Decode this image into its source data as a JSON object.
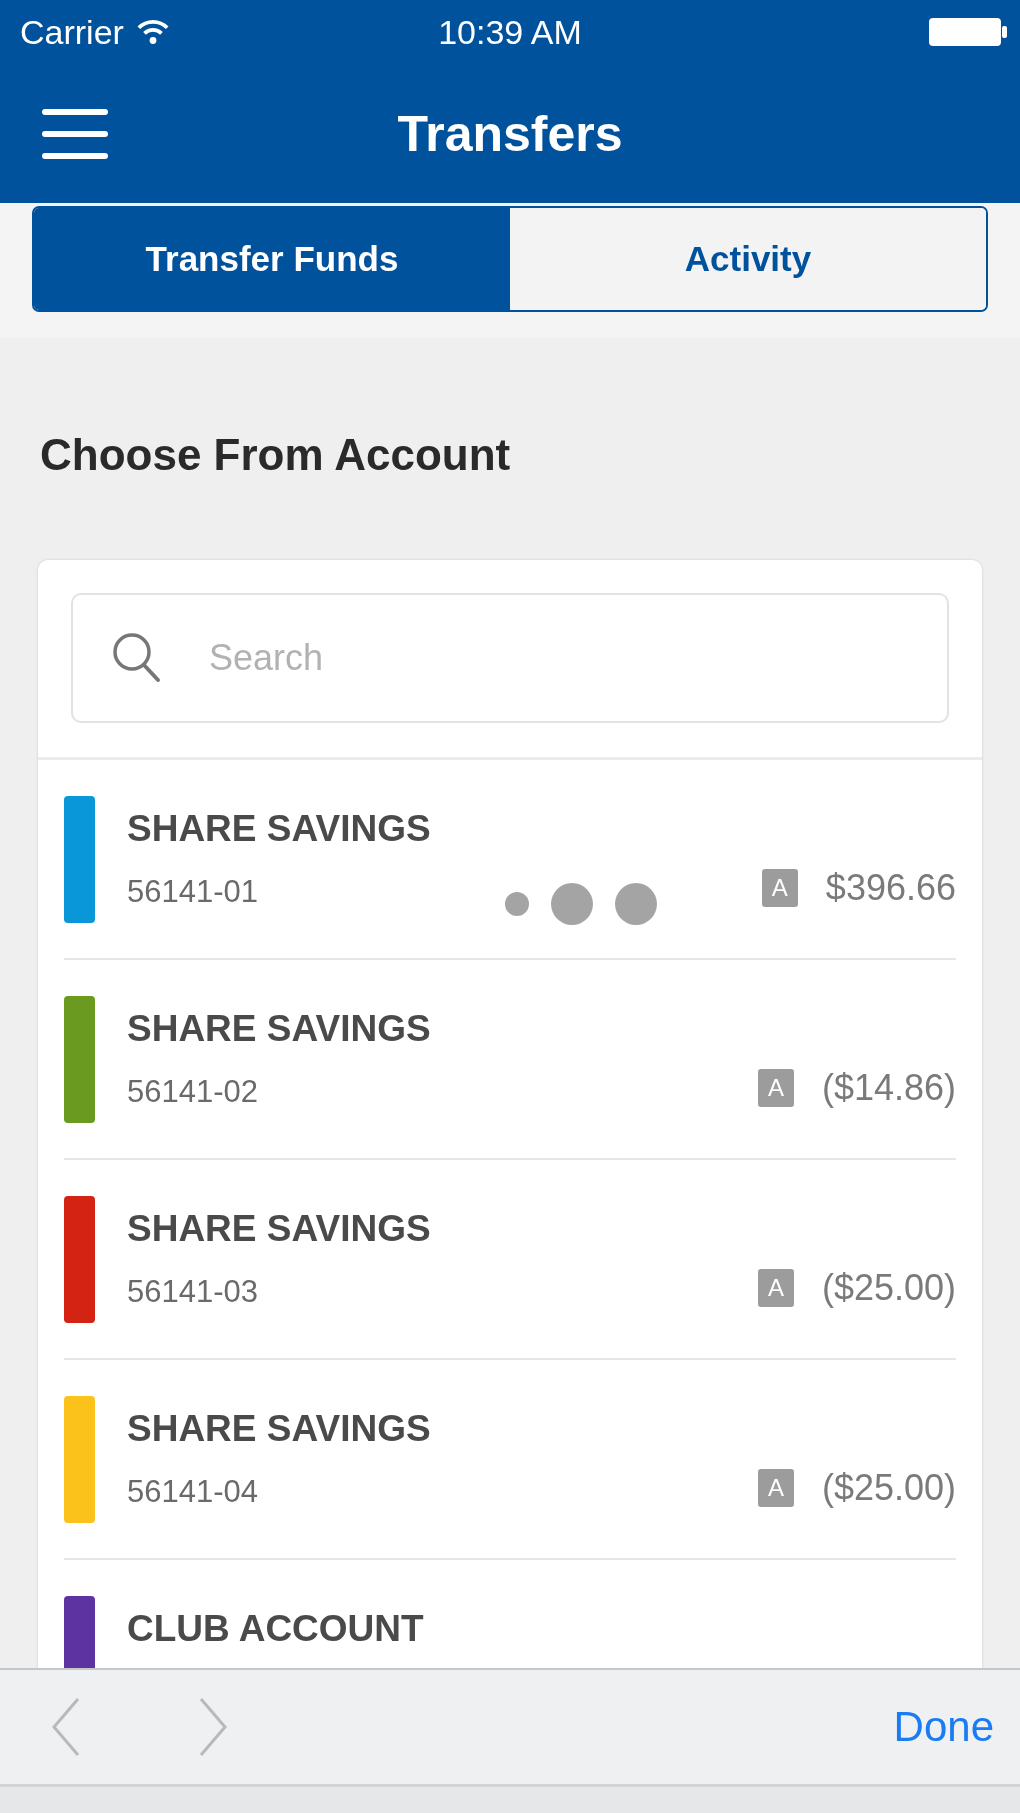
{
  "status_bar": {
    "carrier": "Carrier",
    "time": "10:39 AM"
  },
  "nav": {
    "title": "Transfers"
  },
  "tabs": [
    {
      "label": "Transfer Funds",
      "selected": true
    },
    {
      "label": "Activity",
      "selected": false
    }
  ],
  "heading": "Choose From Account",
  "search": {
    "placeholder": "Search"
  },
  "accounts": [
    {
      "name": "SHARE SAVINGS",
      "number": "56141-01",
      "badge": "A",
      "amount": "$396.66",
      "color": "#0a97d9",
      "loading": true
    },
    {
      "name": "SHARE SAVINGS",
      "number": "56141-02",
      "badge": "A",
      "amount": "($14.86)",
      "color": "#6a9a1f",
      "loading": false
    },
    {
      "name": "SHARE SAVINGS",
      "number": "56141-03",
      "badge": "A",
      "amount": "($25.00)",
      "color": "#d42213",
      "loading": false
    },
    {
      "name": "SHARE SAVINGS",
      "number": "56141-04",
      "badge": "A",
      "amount": "($25.00)",
      "color": "#fcc21c",
      "loading": false
    },
    {
      "name": "CLUB ACCOUNT",
      "color": "#5c33a0",
      "loading": false
    }
  ],
  "toolbar": {
    "done": "Done"
  }
}
